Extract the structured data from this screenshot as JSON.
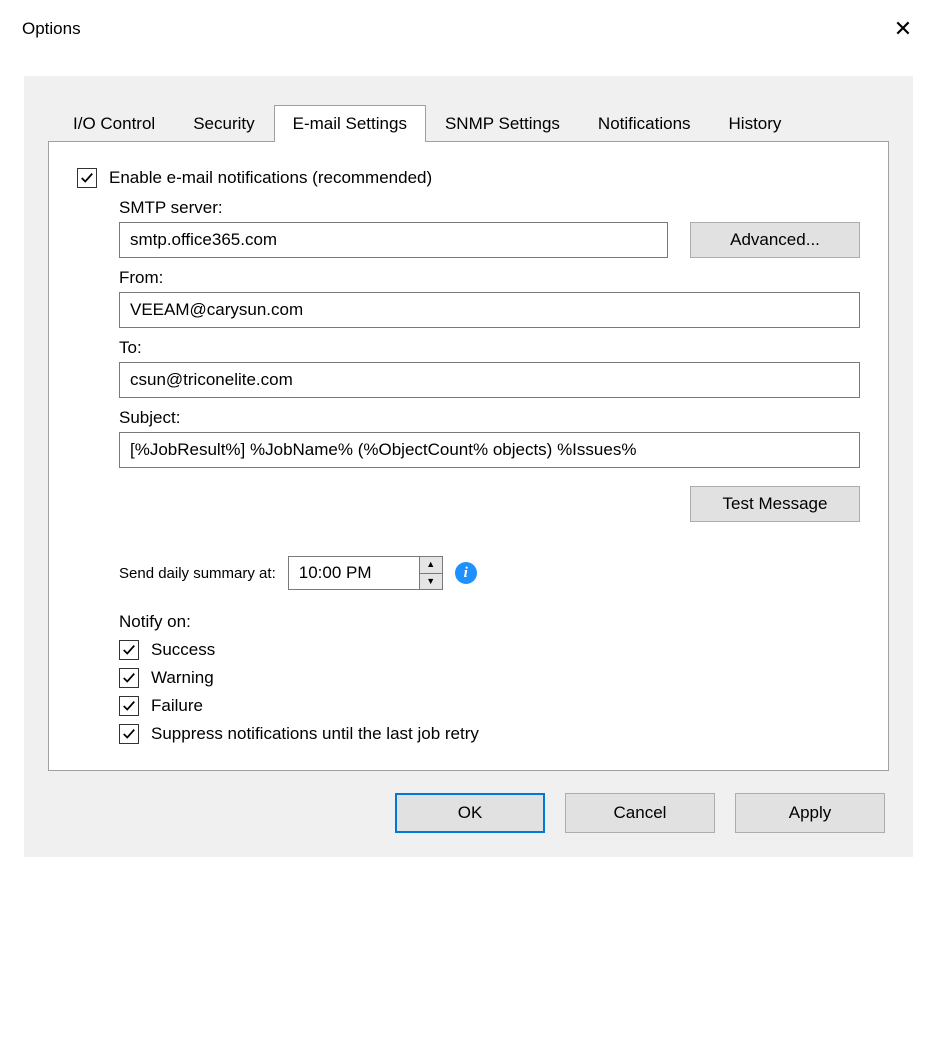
{
  "window": {
    "title": "Options"
  },
  "tabs": [
    {
      "label": "I/O Control"
    },
    {
      "label": "Security"
    },
    {
      "label": "E-mail Settings"
    },
    {
      "label": "SNMP Settings"
    },
    {
      "label": "Notifications"
    },
    {
      "label": "History"
    }
  ],
  "active_tab_index": 2,
  "email": {
    "enable_label": "Enable e-mail notifications (recommended)",
    "enable_checked": true,
    "smtp_label": "SMTP server:",
    "smtp_value": "smtp.office365.com",
    "advanced_btn": "Advanced...",
    "from_label": "From:",
    "from_value": "VEEAM@carysun.com",
    "to_label": "To:",
    "to_value": "csun@triconelite.com",
    "subject_label": "Subject:",
    "subject_value": "[%JobResult%] %JobName% (%ObjectCount% objects) %Issues%",
    "test_btn": "Test Message",
    "summary_label": "Send daily summary at:",
    "summary_time": "10:00 PM",
    "notify_label": "Notify on:",
    "notify": [
      {
        "label": "Success",
        "checked": true
      },
      {
        "label": "Warning",
        "checked": true
      },
      {
        "label": "Failure",
        "checked": true
      },
      {
        "label": "Suppress notifications until the last job retry",
        "checked": true
      }
    ]
  },
  "footer": {
    "ok": "OK",
    "cancel": "Cancel",
    "apply": "Apply"
  }
}
